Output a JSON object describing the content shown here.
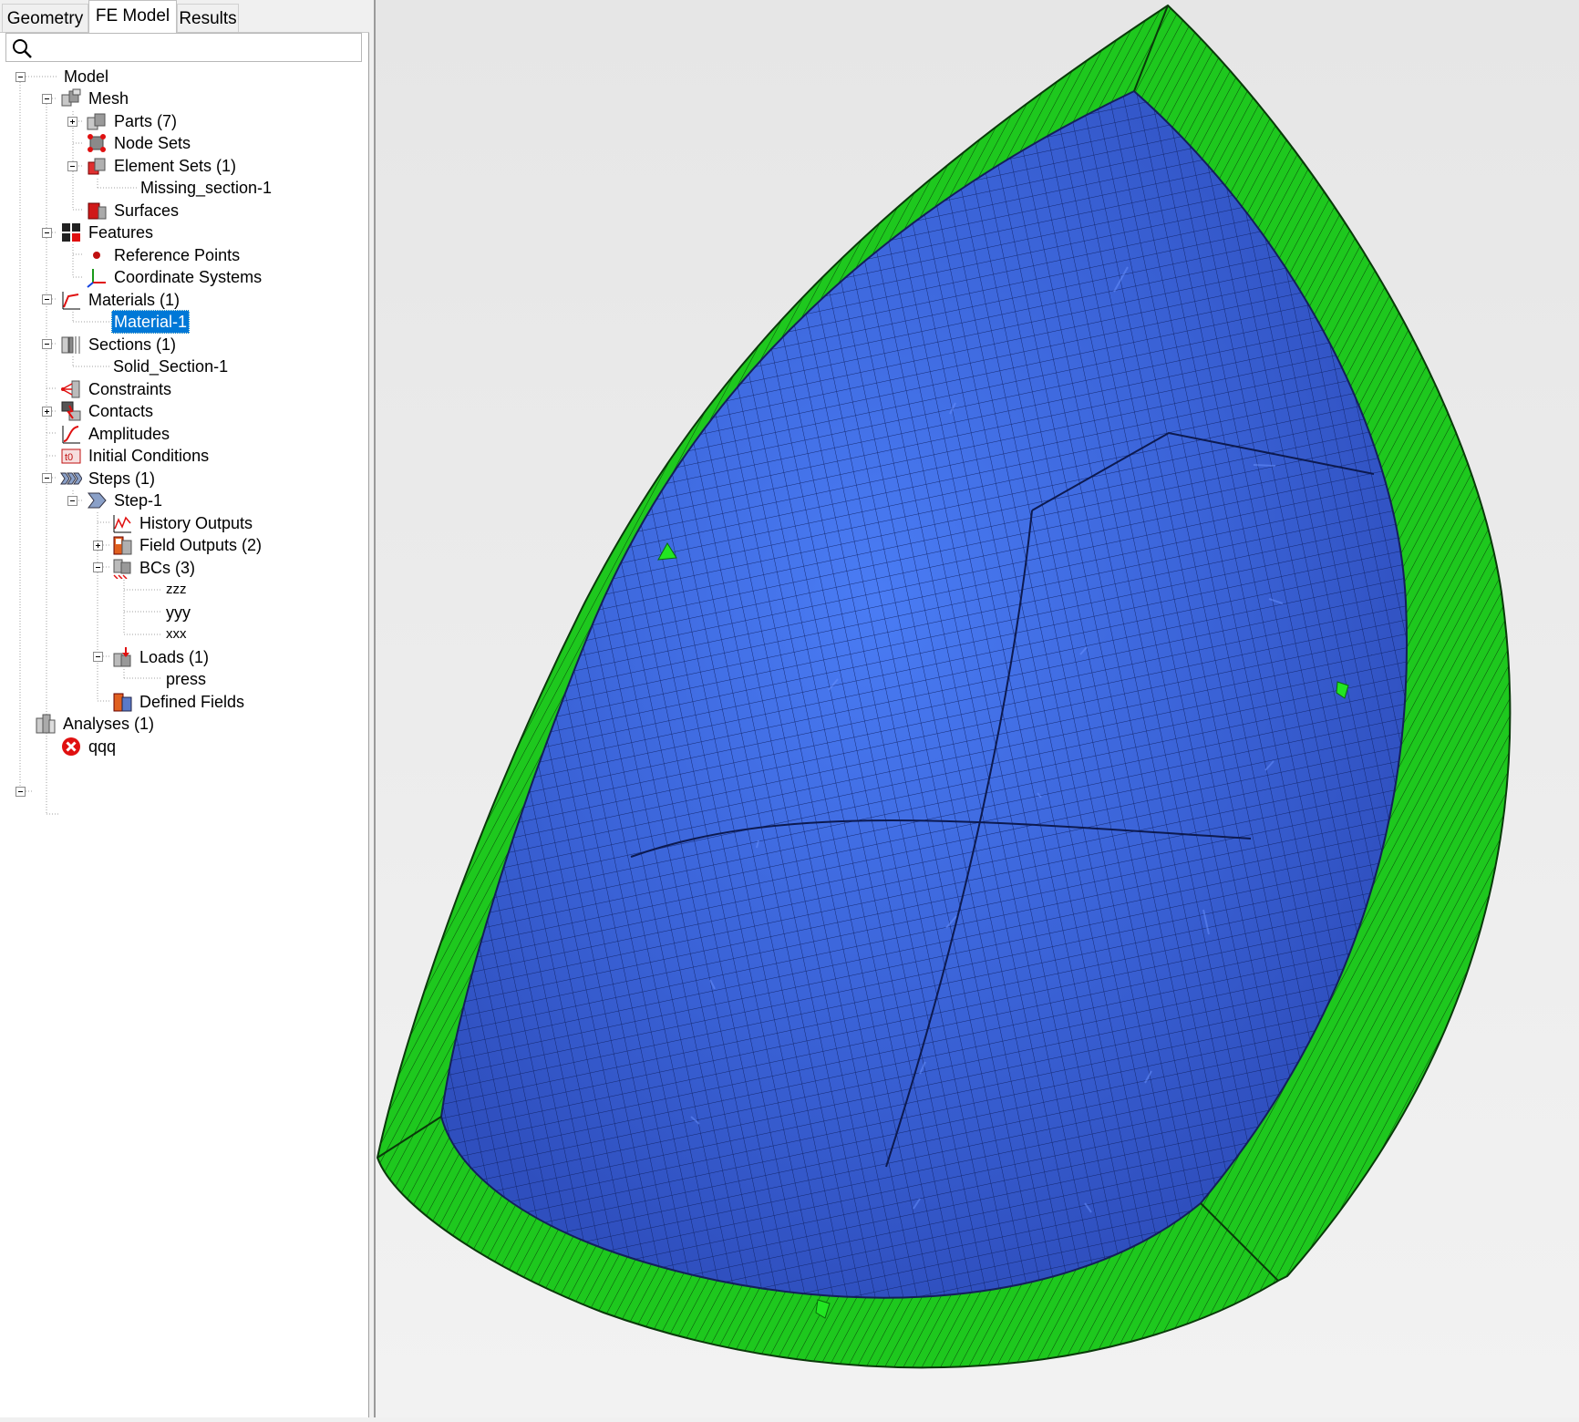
{
  "tabs": [
    "Geometry",
    "FE Model",
    "Results"
  ],
  "active_tab": "FE Model",
  "search": {
    "placeholder": "",
    "value": ""
  },
  "tree": {
    "model": "Model",
    "mesh": "Mesh",
    "parts": "Parts (7)",
    "node_sets": "Node Sets",
    "element_sets": "Element Sets (1)",
    "missing_section": "Missing_section-1",
    "surfaces": "Surfaces",
    "features": "Features",
    "reference_points": "Reference Points",
    "coordinate_systems": "Coordinate Systems",
    "materials": "Materials (1)",
    "material_1": "Material-1",
    "sections": "Sections (1)",
    "solid_section": "Solid_Section-1",
    "constraints": "Constraints",
    "contacts": "Contacts",
    "amplitudes": "Amplitudes",
    "initial_conditions": "Initial Conditions",
    "steps": "Steps (1)",
    "step_1": "Step-1",
    "history_outputs": "History Outputs",
    "field_outputs": "Field Outputs (2)",
    "bcs": "BCs (3)",
    "bc_zzz": "zzz",
    "bc_yyy": "yyy",
    "bc_xxx": "xxx",
    "loads": "Loads (1)",
    "press": "press",
    "defined_fields": "Defined Fields",
    "analyses": "Analyses (1)",
    "analysis_qqq": "qqq"
  },
  "colors": {
    "selection": "#0078d7",
    "mesh_outer": "#1ec81e",
    "mesh_inner": "#3c64dc",
    "error": "#e01010",
    "viewport_bg": "#ececec"
  },
  "icons": {
    "model": "none",
    "mesh": "mesh-icon",
    "parts": "parts-icon",
    "node_sets": "node-set-icon",
    "element_sets": "element-set-icon",
    "surfaces": "surface-icon",
    "features": "features-icon",
    "reference_points": "reference-point-icon",
    "coordinate_systems": "coordinate-system-icon",
    "materials": "material-icon",
    "sections": "section-icon",
    "constraints": "constraint-icon",
    "contacts": "contact-icon",
    "amplitudes": "amplitude-icon",
    "initial_conditions": "initial-conditions-icon",
    "steps": "steps-icon",
    "step_1": "step-icon",
    "history_outputs": "history-output-icon",
    "field_outputs": "field-output-icon",
    "bcs": "bc-icon",
    "loads": "load-icon",
    "defined_fields": "defined-field-icon",
    "analyses": "analysis-icon",
    "analysis_qqq": "error-icon"
  }
}
